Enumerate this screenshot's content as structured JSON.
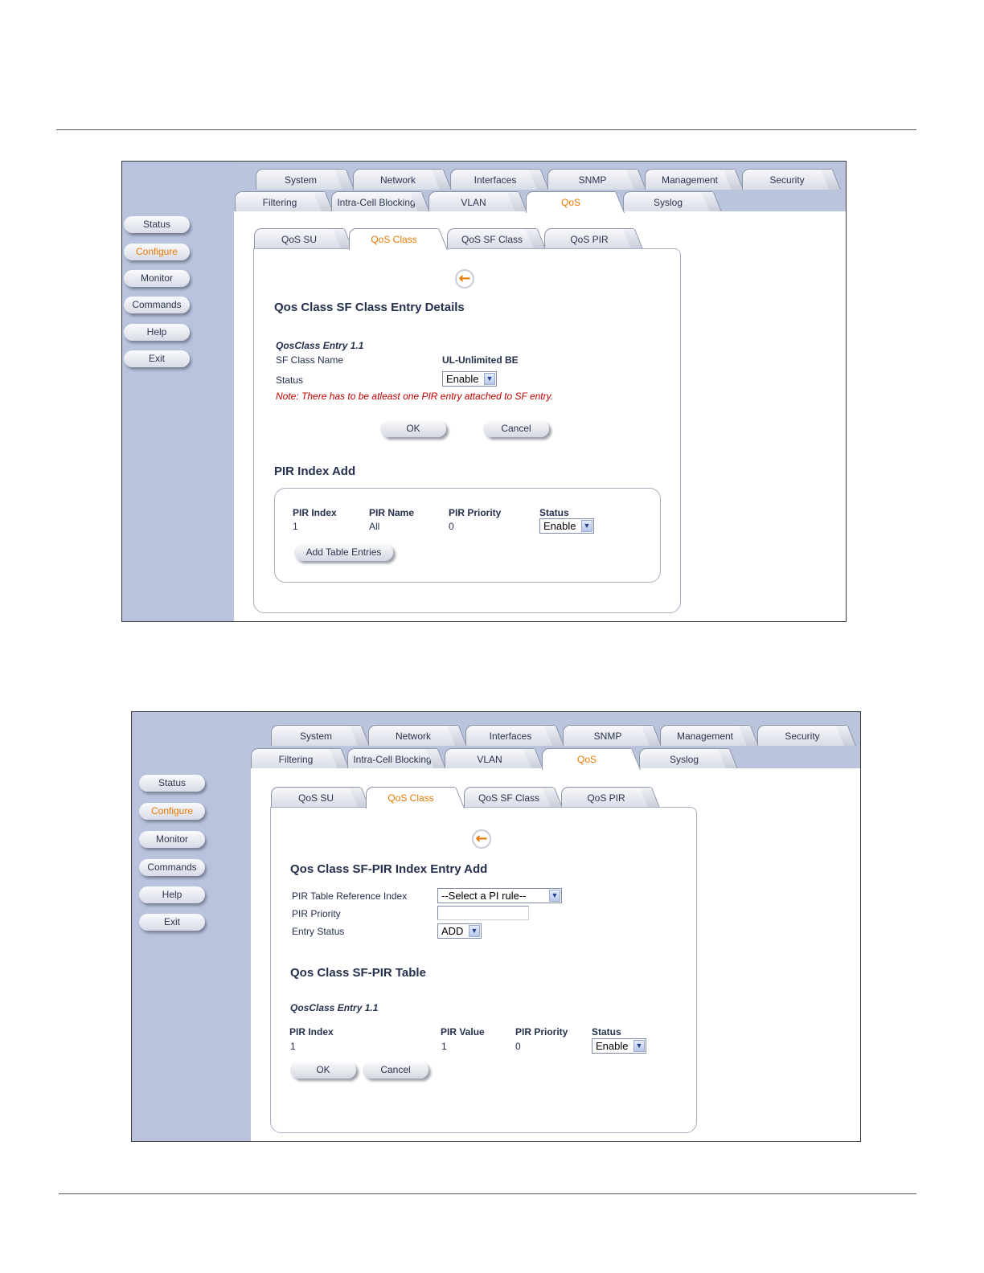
{
  "sidebar": {
    "items": [
      {
        "label": "Status",
        "active": false
      },
      {
        "label": "Configure",
        "active": true
      },
      {
        "label": "Monitor",
        "active": false
      },
      {
        "label": "Commands",
        "active": false
      },
      {
        "label": "Help",
        "active": false
      },
      {
        "label": "Exit",
        "active": false
      }
    ]
  },
  "top_tabs": [
    "System",
    "Network",
    "Interfaces",
    "SNMP",
    "Management",
    "Security"
  ],
  "second_tabs": [
    "Filtering",
    "Intra-Cell Blocking",
    "VLAN",
    "QoS",
    "Syslog"
  ],
  "second_tabs_active": "QoS",
  "sub_tabs": [
    "QoS SU",
    "QoS Class",
    "QoS SF Class",
    "QoS PIR"
  ],
  "sub_tabs_active": "QoS Class",
  "screen1": {
    "heading": "Qos Class SF Class Entry Details",
    "entry_title": "QosClass Entry 1.1",
    "sf_class_name_label": "SF Class Name",
    "sf_class_name_value": "UL-Unlimited BE",
    "status_label": "Status",
    "status_value": "Enable",
    "note": "Note: There has to be atleast one PIR entry attached to SF entry.",
    "ok": "OK",
    "cancel": "Cancel",
    "pir_heading": "PIR Index Add",
    "pir_table": {
      "headers": [
        "PIR Index",
        "PIR Name",
        "PIR Priority",
        "Status"
      ],
      "row": [
        "1",
        "All",
        "0",
        "Enable"
      ]
    },
    "add_button": "Add Table Entries"
  },
  "screen2": {
    "heading": "Qos Class SF-PIR Index Entry Add",
    "ref_index_label": "PIR Table Reference Index",
    "ref_index_value": "--Select a PI rule--",
    "priority_label": "PIR Priority",
    "priority_value": "",
    "entry_status_label": "Entry Status",
    "entry_status_value": "ADD",
    "table_heading": "Qos Class SF-PIR Table",
    "entry_title": "QosClass Entry 1.1",
    "table": {
      "headers": [
        "PIR Index",
        "PIR Value",
        "PIR Priority",
        "Status"
      ],
      "row": [
        "1",
        "1",
        "0",
        "Enable"
      ]
    },
    "ok": "OK",
    "cancel": "Cancel"
  },
  "icons": {
    "back": "back-arrow-icon",
    "dropdown": "chevron-down-icon"
  },
  "colors": {
    "active": "#e67a00",
    "sidebar": "#b9c3dd",
    "note": "#c00000"
  }
}
